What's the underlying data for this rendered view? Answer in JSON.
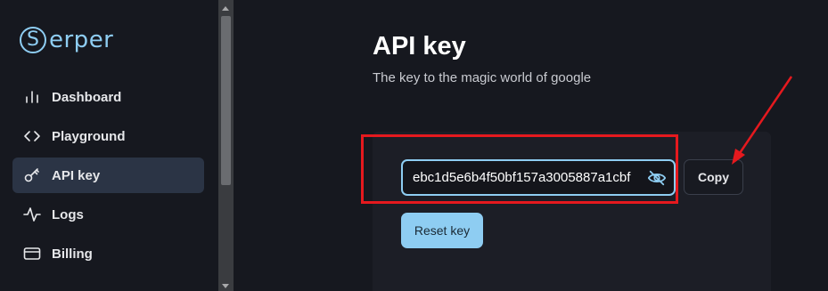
{
  "brand": {
    "logo_letter": "S",
    "logo_rest": "erper",
    "color": "#8ecdf2"
  },
  "sidebar": {
    "items": [
      {
        "label": "Dashboard",
        "icon": "bar-chart-icon",
        "active": false
      },
      {
        "label": "Playground",
        "icon": "code-icon",
        "active": false
      },
      {
        "label": "API key",
        "icon": "key-icon",
        "active": true
      },
      {
        "label": "Logs",
        "icon": "activity-icon",
        "active": false
      },
      {
        "label": "Billing",
        "icon": "credit-card-icon",
        "active": false
      }
    ]
  },
  "main": {
    "title": "API key",
    "subtitle": "The key to the magic world of google",
    "api_key_value": "ebc1d5e6b4f50bf157a3005887a1cbf",
    "copy_label": "Copy",
    "reset_label": "Reset key",
    "visibility_icon": "eye-off-icon"
  },
  "annotations": {
    "highlight_color": "#e5191e",
    "arrow_color": "#e5191e"
  }
}
